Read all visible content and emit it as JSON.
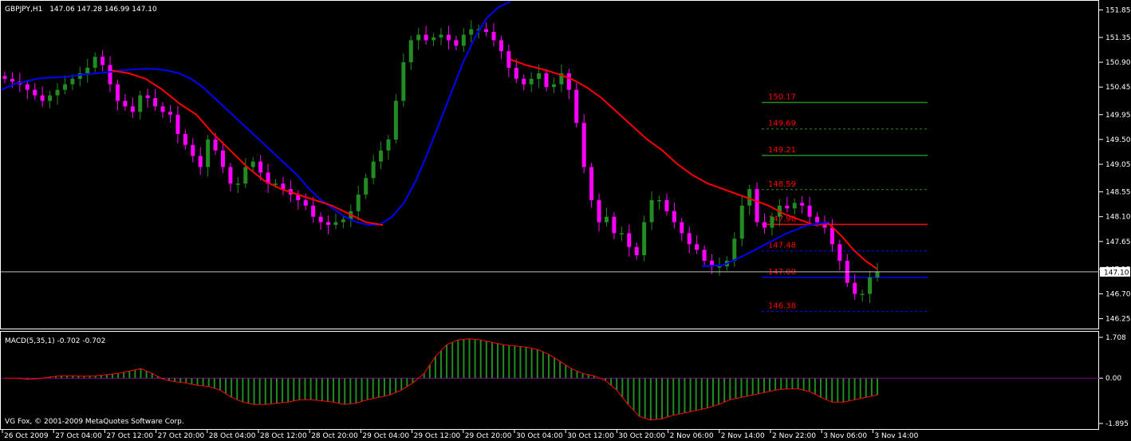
{
  "header": {
    "symbol_label": "GBPJPY,H1",
    "ohlc": "147.06 147.28 146.99 147.10"
  },
  "macd_header": "MACD(5,35,1) -0.702 -0.702",
  "copyright": "VG Fox, © 2001-2009 MetaQuotes Software Corp.",
  "colors": {
    "bull": "#228B22",
    "bear": "#FF00FF",
    "ma_fast": "#0000FF",
    "ma_slow": "#FF0000",
    "level_green": "#228B22",
    "level_red": "#FF0000",
    "level_blue": "#0000FF",
    "level_text": "#FF0000",
    "macd_line": "#FF0000",
    "macd_hist": "#228B22",
    "zero_line": "#800080"
  },
  "chart_data": {
    "type": "candlestick",
    "symbol": "GBPJPY",
    "timeframe": "H1",
    "ylim": [
      146.1,
      152.0
    ],
    "price_ticks": [
      "151.85",
      "151.35",
      "150.90",
      "150.45",
      "149.95",
      "149.50",
      "149.05",
      "148.55",
      "148.10",
      "147.65",
      "147.15",
      "146.70",
      "146.25"
    ],
    "current_price": "147.10",
    "time_ticks": [
      "26 Oct 2009",
      "27 Oct 04:00",
      "27 Oct 12:00",
      "27 Oct 20:00",
      "28 Oct 04:00",
      "28 Oct 12:00",
      "28 Oct 20:00",
      "29 Oct 04:00",
      "29 Oct 12:00",
      "29 Oct 20:00",
      "30 Oct 04:00",
      "30 Oct 12:00",
      "30 Oct 20:00",
      "2 Nov 06:00",
      "2 Nov 14:00",
      "2 Nov 22:00",
      "3 Nov 06:00",
      "3 Nov 14:00"
    ],
    "close_path": [
      150.6,
      150.55,
      150.5,
      150.4,
      150.3,
      150.2,
      150.3,
      150.4,
      150.5,
      150.6,
      150.7,
      150.8,
      151.0,
      150.85,
      150.5,
      150.2,
      150.1,
      150.0,
      150.3,
      150.25,
      150.1,
      150.0,
      149.95,
      149.6,
      149.4,
      149.2,
      149.0,
      149.5,
      149.3,
      149.0,
      148.7,
      148.7,
      149.0,
      149.1,
      148.9,
      148.7,
      148.7,
      148.6,
      148.5,
      148.4,
      148.3,
      148.1,
      148.0,
      147.95,
      148.0,
      148.05,
      148.2,
      148.5,
      148.8,
      149.1,
      149.3,
      149.5,
      150.2,
      150.9,
      151.3,
      151.4,
      151.3,
      151.35,
      151.4,
      151.3,
      151.2,
      151.4,
      151.5,
      151.5,
      151.45,
      151.3,
      151.1,
      150.8,
      150.6,
      150.5,
      150.6,
      150.7,
      150.45,
      150.5,
      150.7,
      150.4,
      149.8,
      149.0,
      148.4,
      148.0,
      148.1,
      147.8,
      147.8,
      147.55,
      147.4,
      148.0,
      148.4,
      148.4,
      148.2,
      148.0,
      147.8,
      147.6,
      147.5,
      147.3,
      147.2,
      147.2,
      147.3,
      147.7,
      148.3,
      148.6,
      148.0,
      147.9,
      148.1,
      148.3,
      148.25,
      148.35,
      148.3,
      148.1,
      148.0,
      147.9,
      147.6,
      147.3,
      146.9,
      146.7,
      146.7,
      147.0,
      147.1
    ],
    "fast_ma_path": [
      150.4,
      150.5,
      150.55,
      150.6,
      150.62,
      150.63,
      150.65,
      150.68,
      150.7,
      150.72,
      150.75,
      150.77,
      150.78,
      150.78,
      150.75,
      150.7,
      150.6,
      150.45,
      150.25,
      150.05,
      149.85,
      149.65,
      149.45,
      149.25,
      149.05,
      148.85,
      148.6,
      148.4,
      148.25,
      148.1,
      148.0,
      147.95,
      147.96,
      148.1,
      148.35,
      148.75,
      149.25,
      149.8,
      150.35,
      150.9,
      151.35,
      151.7,
      151.9,
      152.0
    ],
    "slow_ma_path": [
      150.95,
      150.85,
      150.78,
      150.7,
      150.6,
      150.45,
      150.25,
      150.0,
      149.75,
      149.5,
      149.3,
      149.05,
      148.85,
      148.7,
      148.6,
      148.5,
      148.4,
      148.3,
      148.15,
      148.05,
      147.95,
      147.97
    ],
    "levels": [
      {
        "label": "150.17",
        "price": 150.17,
        "style": "solid",
        "color": "green"
      },
      {
        "label": "149.69",
        "price": 149.69,
        "style": "dashed",
        "color": "green"
      },
      {
        "label": "149.21",
        "price": 149.21,
        "style": "solid",
        "color": "green"
      },
      {
        "label": "148.59",
        "price": 148.59,
        "style": "dashed",
        "color": "green"
      },
      {
        "label": "147.96",
        "price": 147.96,
        "style": "solid",
        "color": "red"
      },
      {
        "label": "147.48",
        "price": 147.48,
        "style": "dashed",
        "color": "blue"
      },
      {
        "label": "147.00",
        "price": 147.0,
        "style": "solid",
        "color": "blue"
      },
      {
        "label": "146.38",
        "price": 146.38,
        "style": "dashed",
        "color": "blue"
      }
    ],
    "macd": {
      "name": "MACD(5,35,1)",
      "value": "-0.702",
      "ylim": [
        -1.895,
        1.708
      ],
      "ticks": [
        "1.708",
        "0.00",
        "-1.895"
      ],
      "hist_path": [
        0.0,
        0.0,
        -0.05,
        -0.02,
        0.05,
        0.1,
        0.1,
        0.08,
        0.1,
        0.15,
        0.2,
        0.3,
        0.4,
        0.2,
        -0.05,
        -0.15,
        -0.2,
        -0.3,
        -0.35,
        -0.5,
        -0.8,
        -1.0,
        -1.1,
        -1.1,
        -1.05,
        -1.0,
        -0.9,
        -0.9,
        -0.95,
        -1.0,
        -1.1,
        -1.05,
        -0.9,
        -0.8,
        -0.7,
        -0.5,
        -0.2,
        0.2,
        0.9,
        1.4,
        1.6,
        1.65,
        1.6,
        1.5,
        1.4,
        1.35,
        1.3,
        1.2,
        1.0,
        0.7,
        0.4,
        0.2,
        0.1,
        -0.1,
        -0.5,
        -1.1,
        -1.6,
        -1.75,
        -1.7,
        -1.55,
        -1.45,
        -1.35,
        -1.25,
        -1.1,
        -0.9,
        -0.8,
        -0.7,
        -0.6,
        -0.5,
        -0.45,
        -0.45,
        -0.55,
        -0.8,
        -1.0,
        -1.0,
        -0.9,
        -0.8,
        -0.7
      ]
    }
  }
}
